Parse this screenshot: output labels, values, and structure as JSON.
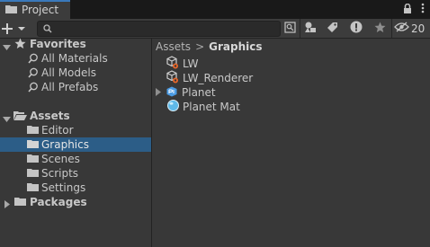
{
  "tab": {
    "title": "Project"
  },
  "toolbar": {
    "search_value": "",
    "hidden_count": "20"
  },
  "tree": {
    "favorites": {
      "label": "Favorites",
      "items": [
        "All Materials",
        "All Models",
        "All Prefabs"
      ]
    },
    "assets": {
      "label": "Assets",
      "children": [
        "Editor",
        "Graphics",
        "Scenes",
        "Scripts",
        "Settings"
      ],
      "selected": "Graphics"
    },
    "packages": {
      "label": "Packages"
    }
  },
  "breadcrumb": {
    "root": "Assets",
    "separator": ">",
    "current": "Graphics"
  },
  "content": {
    "items": [
      {
        "name": "LW",
        "icon": "render-pipeline-asset-icon"
      },
      {
        "name": "LW_Renderer",
        "icon": "render-pipeline-asset-icon"
      },
      {
        "name": "Planet",
        "icon": "prefab-icon"
      },
      {
        "name": "Planet Mat",
        "icon": "material-sphere-icon"
      }
    ]
  },
  "colors": {
    "accent": "#3a79bb",
    "selection": "#2c5d87",
    "panel": "#383838",
    "toolbar": "#3c3c3c"
  }
}
